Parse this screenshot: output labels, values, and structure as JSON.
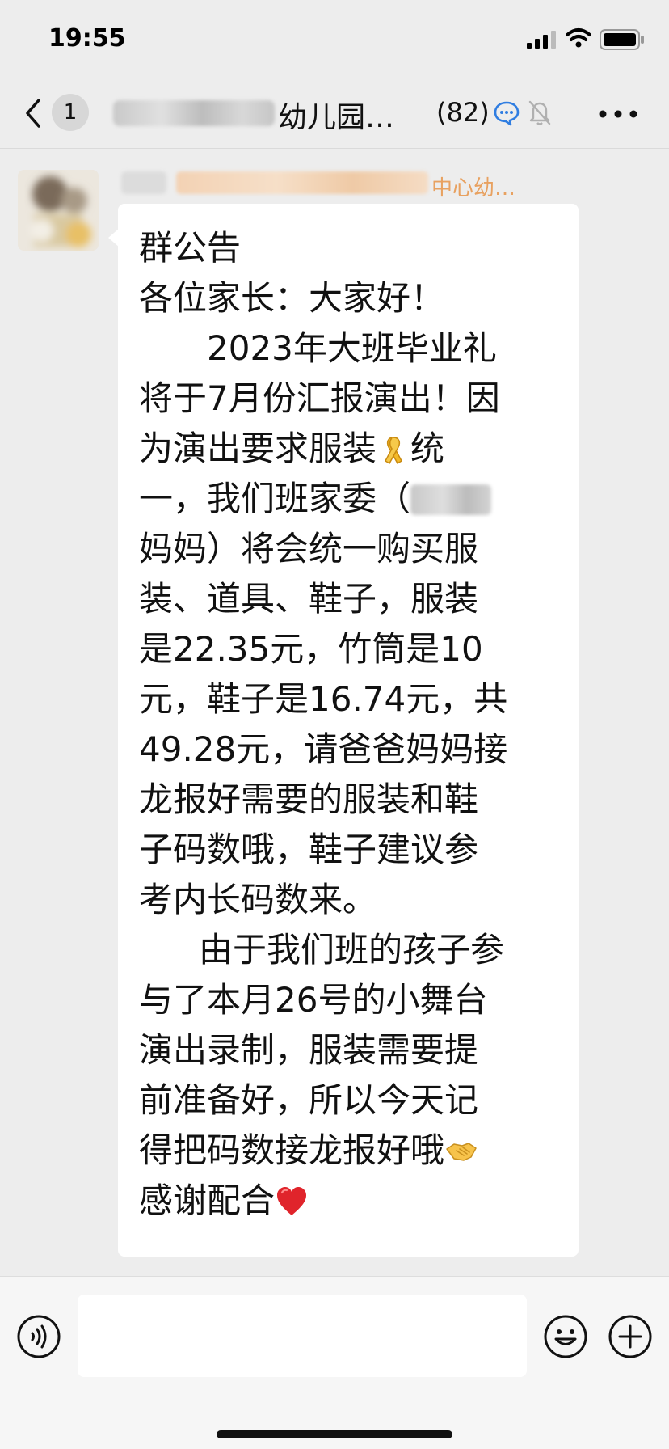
{
  "status_bar": {
    "time": "19:55"
  },
  "nav": {
    "unread_count": "1",
    "title": "幼儿园…",
    "member_count": "(82)"
  },
  "message": {
    "sender_name_visible": "中心幼…",
    "lines": [
      "群公告",
      "各位家长：大家好！",
      "2023年大班毕业礼",
      "将于7月份汇报演出！因",
      "为演出要求服装",
      "统",
      "一，我们班家委（",
      "妈妈）将会统一购买服",
      "装、道具、鞋子，服装",
      "是22.35元，竹筒是10",
      "元，鞋子是16.74元，共",
      "49.28元，请爸爸妈妈接",
      "龙报好需要的服装和鞋",
      "子码数哦，鞋子建议参",
      "考内长码数来。",
      "由于我们班的孩子参",
      "与了本月26号的小舞台",
      "演出录制，服装需要提",
      "前准备好，所以今天记",
      "得把码数接龙报好哦",
      "感谢配合"
    ]
  },
  "icons": {
    "ribbon": "yellow-ribbon-icon",
    "handshake": "handshake-icon",
    "heart": "red-heart-icon"
  },
  "colors": {
    "background": "#EDEDED",
    "bubble": "#FFFFFF",
    "sender_name": "#E8A160",
    "heart": "#E0242B"
  }
}
